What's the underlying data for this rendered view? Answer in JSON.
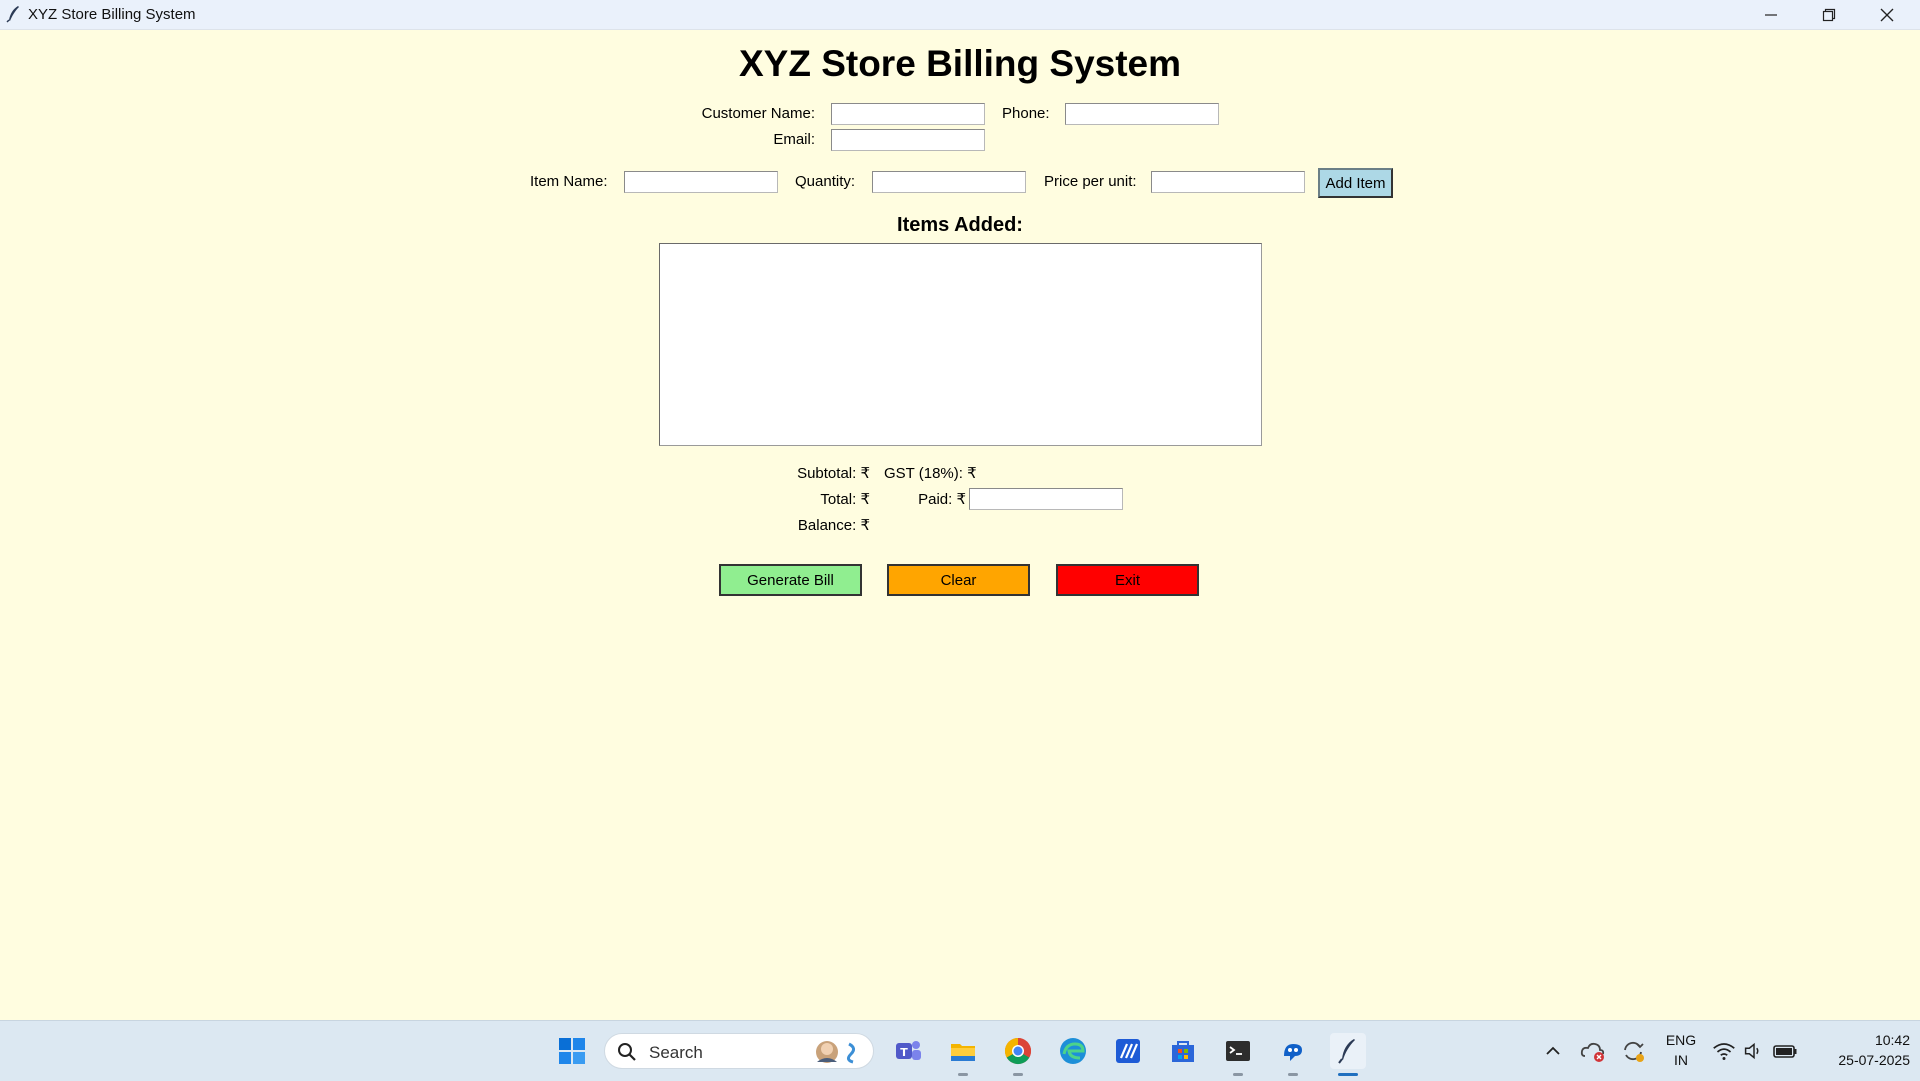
{
  "window": {
    "title": "XYZ Store Billing System"
  },
  "app": {
    "heading": "XYZ Store Billing System",
    "customer": {
      "name_label": "Customer Name:",
      "name_value": "",
      "phone_label": "Phone:",
      "phone_value": "",
      "email_label": "Email:",
      "email_value": ""
    },
    "item_entry": {
      "item_label": "Item Name:",
      "item_value": "",
      "qty_label": "Quantity:",
      "qty_value": "",
      "price_label": "Price per unit:",
      "price_value": "",
      "add_button": "Add Item"
    },
    "items_section_title": "Items Added:",
    "items": [],
    "summary": {
      "subtotal_label": "Subtotal: ₹",
      "gst_label": "GST (18%): ₹",
      "total_label": "Total: ₹",
      "paid_label": "Paid: ₹",
      "paid_value": "",
      "balance_label": "Balance: ₹"
    },
    "buttons": {
      "generate": "Generate Bill",
      "clear": "Clear",
      "exit": "Exit"
    },
    "colors": {
      "background": "#fffde0",
      "generate": "#90ee90",
      "clear": "#ffa500",
      "exit": "#ff0000",
      "add_item": "#add8e6"
    }
  },
  "taskbar": {
    "search_placeholder": "Search",
    "apps": [
      "windows-start-icon",
      "teams-icon",
      "file-explorer-icon",
      "chrome-icon",
      "edge-icon",
      "app-icon",
      "store-icon",
      "terminal-icon",
      "copilot-icon",
      "python-feather-icon"
    ],
    "language_line1": "ENG",
    "language_line2": "IN",
    "time": "10:42",
    "date": "25-07-2025"
  }
}
